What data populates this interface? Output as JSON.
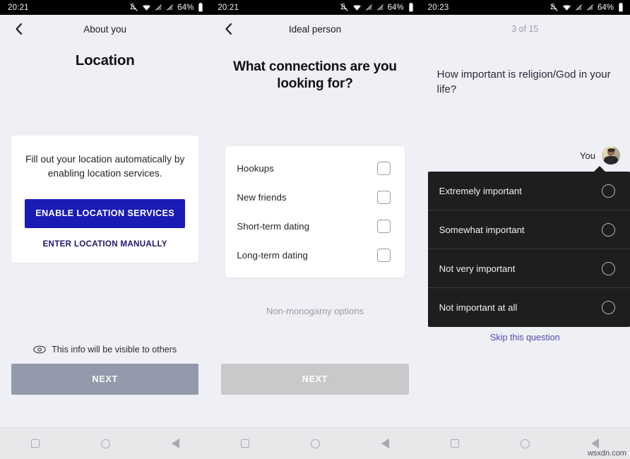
{
  "screens": [
    {
      "status": {
        "time": "20:21",
        "battery": "64%",
        "icons": [
          "bell-off-icon",
          "wifi-icon",
          "signal-off-icon",
          "signal-off-icon",
          "battery-icon"
        ]
      },
      "nav": {
        "back_icon": "chevron-left-icon",
        "title": "About you"
      },
      "page_title": "Location",
      "card": {
        "text": "Fill out your location automatically by enabling location services.",
        "primary_button": "ENABLE LOCATION SERVICES",
        "link_button": "ENTER LOCATION MANUALLY"
      },
      "footer": {
        "eye_icon": "eye-icon",
        "note": "This info will be visible to others",
        "next_label": "NEXT"
      }
    },
    {
      "status": {
        "time": "20:21",
        "battery": "64%"
      },
      "nav": {
        "back_icon": "chevron-left-icon",
        "title": "Ideal person"
      },
      "question": "What connections are you looking for?",
      "options": [
        {
          "label": "Hookups",
          "checked": false
        },
        {
          "label": "New friends",
          "checked": false
        },
        {
          "label": "Short-term dating",
          "checked": false
        },
        {
          "label": "Long-term dating",
          "checked": false
        }
      ],
      "secondary_link": "Non-monogamy options",
      "footer": {
        "next_label": "NEXT"
      }
    },
    {
      "status": {
        "time": "20:23",
        "battery": "64%"
      },
      "nav": {
        "step_counter": "3 of 15"
      },
      "question": "How important is religion/God in your life?",
      "you_label": "You",
      "avatar": "user-avatar",
      "answers": [
        {
          "label": "Extremely important",
          "selected": false
        },
        {
          "label": "Somewhat important",
          "selected": false
        },
        {
          "label": "Not very important",
          "selected": false
        },
        {
          "label": "Not important at all",
          "selected": false
        }
      ],
      "skip_link": "Skip this question"
    }
  ],
  "colors": {
    "page_bg": "#eff0f5",
    "primary_blue": "#1a1ab4",
    "link_navy": "#191970",
    "dark_panel": "#1e1e1f",
    "skip_link": "#4a4ab0",
    "next_slate": "#939aab",
    "next_gray": "#c9c9cc"
  },
  "watermark": "wsxdn.com"
}
